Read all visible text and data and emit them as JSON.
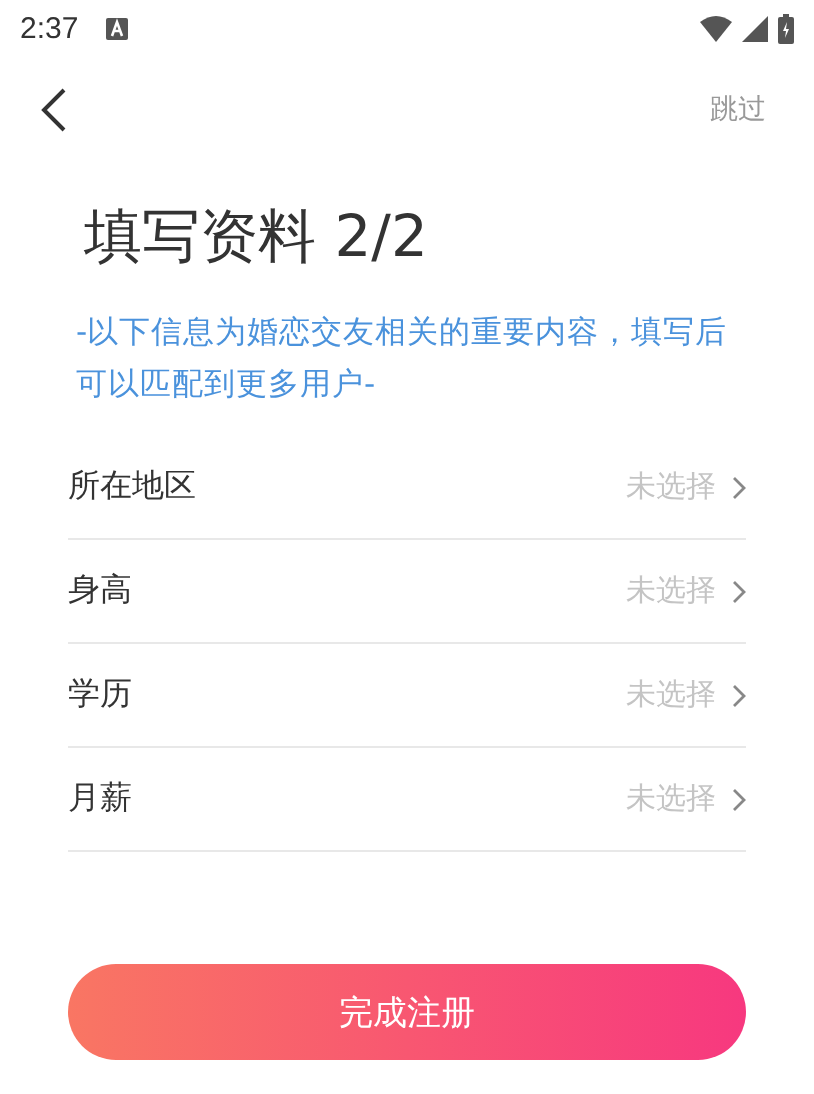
{
  "status_bar": {
    "time": "2:37"
  },
  "nav": {
    "skip": "跳过"
  },
  "title": "填写资料 2/2",
  "subtitle": "-以下信息为婚恋交友相关的重要内容，填写后可以匹配到更多用户-",
  "fields": [
    {
      "label": "所在地区",
      "value": "未选择"
    },
    {
      "label": "身高",
      "value": "未选择"
    },
    {
      "label": "学历",
      "value": "未选择"
    },
    {
      "label": "月薪",
      "value": "未选择"
    }
  ],
  "submit": "完成注册"
}
